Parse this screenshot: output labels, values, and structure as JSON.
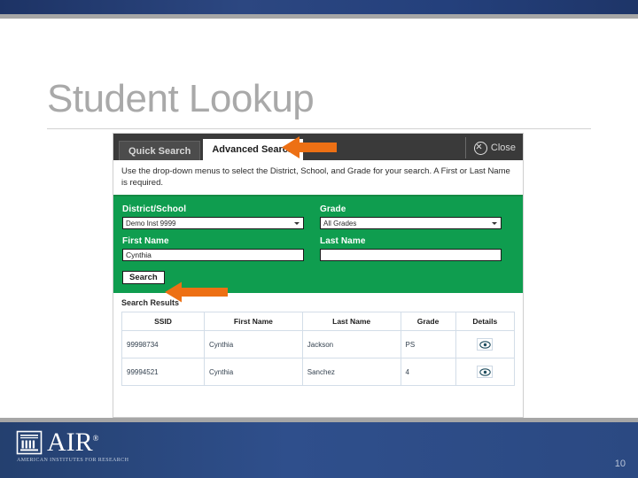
{
  "slide": {
    "title": "Student Lookup",
    "page_number": "10",
    "accent_blue": "#2c4a84",
    "title_gray": "#a9a9a9"
  },
  "brand": {
    "name": "AIR",
    "trademark": "®",
    "tagline": "AMERICAN INSTITUTES FOR RESEARCH",
    "logo_icon": "air-building-icon"
  },
  "app": {
    "tabs": [
      {
        "label": "Quick Search",
        "active": false
      },
      {
        "label": "Advanced Search",
        "active": true
      }
    ],
    "close_label": "Close",
    "close_icon": "close-circle-icon",
    "instructions": "Use the drop-down menus to select the District, School, and Grade for your search. A First or Last Name is required.",
    "form": {
      "accent_green": "#0f9d4f",
      "district_label": "District/School",
      "district_value": "Demo Inst 9999",
      "grade_label": "Grade",
      "grade_value": "All Grades",
      "first_name_label": "First Name",
      "first_name_value": "Cynthia",
      "last_name_label": "Last Name",
      "last_name_value": "",
      "search_label": "Search"
    },
    "results": {
      "heading": "Search Results",
      "columns": [
        "SSID",
        "First Name",
        "Last Name",
        "Grade",
        "Details"
      ],
      "rows": [
        {
          "ssid": "99998734",
          "first_name": "Cynthia",
          "last_name": "Jackson",
          "grade": "PS",
          "details_icon": "eye-icon"
        },
        {
          "ssid": "99994521",
          "first_name": "Cynthia",
          "last_name": "Sanchez",
          "grade": "4",
          "details_icon": "eye-icon"
        }
      ]
    }
  },
  "annotations": {
    "arrow_color": "#ED7014",
    "arrow_tab": {
      "target": "Advanced Search",
      "direction": "left"
    },
    "arrow_search": {
      "target": "Search",
      "direction": "left"
    }
  }
}
